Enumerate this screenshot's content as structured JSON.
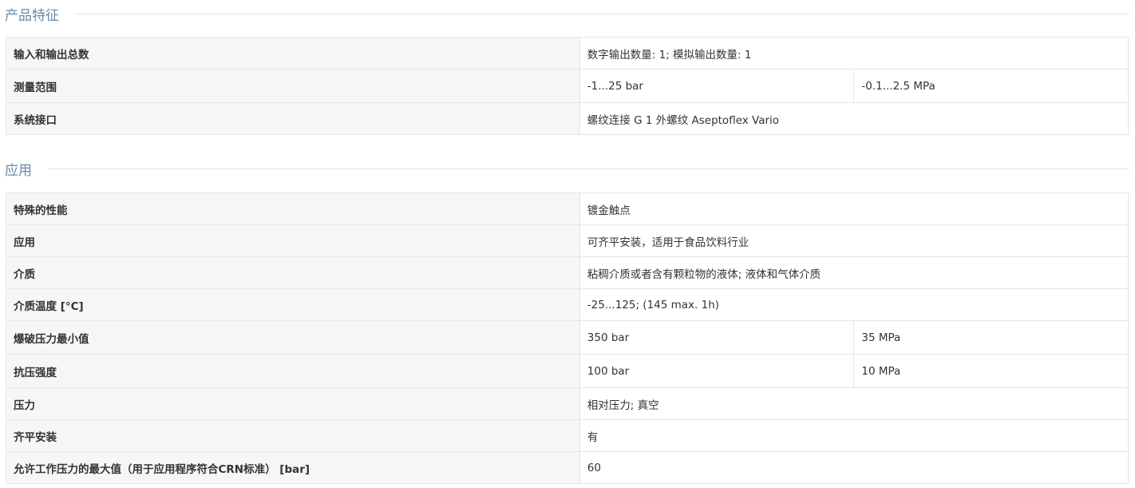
{
  "sections": [
    {
      "title": "产品特征",
      "rows": [
        {
          "label": "输入和输出总数",
          "value": "数字输出数量: 1; 模拟输出数量: 1",
          "value2": ""
        },
        {
          "label": "测量范围",
          "value": "-1...25 bar",
          "value2": "-0.1...2.5 MPa"
        },
        {
          "label": "系统接口",
          "value": "螺纹连接 G 1 外螺纹 Aseptoflex Vario",
          "value2": ""
        }
      ]
    },
    {
      "title": "应用",
      "rows": [
        {
          "label": "特殊的性能",
          "value": "镀金触点",
          "value2": ""
        },
        {
          "label": "应用",
          "value": "可齐平安装，适用于食品饮料行业",
          "value2": ""
        },
        {
          "label": "介质",
          "value": "粘稠介质或者含有颗粒物的液体; 液体和气体介质",
          "value2": ""
        },
        {
          "label": "介质温度 [°C]",
          "value": "-25...125; (145 max. 1h)",
          "value2": ""
        },
        {
          "label": "爆破压力最小值",
          "value": "350 bar",
          "value2": "35 MPa"
        },
        {
          "label": "抗压强度",
          "value": "100 bar",
          "value2": "10 MPa"
        },
        {
          "label": "压力",
          "value": "相对压力; 真空",
          "value2": ""
        },
        {
          "label": "齐平安装",
          "value": "有",
          "value2": ""
        },
        {
          "label": "允许工作压力的最大值（用于应用程序符合CRN标准） [bar]",
          "value": "60",
          "value2": ""
        }
      ]
    }
  ]
}
